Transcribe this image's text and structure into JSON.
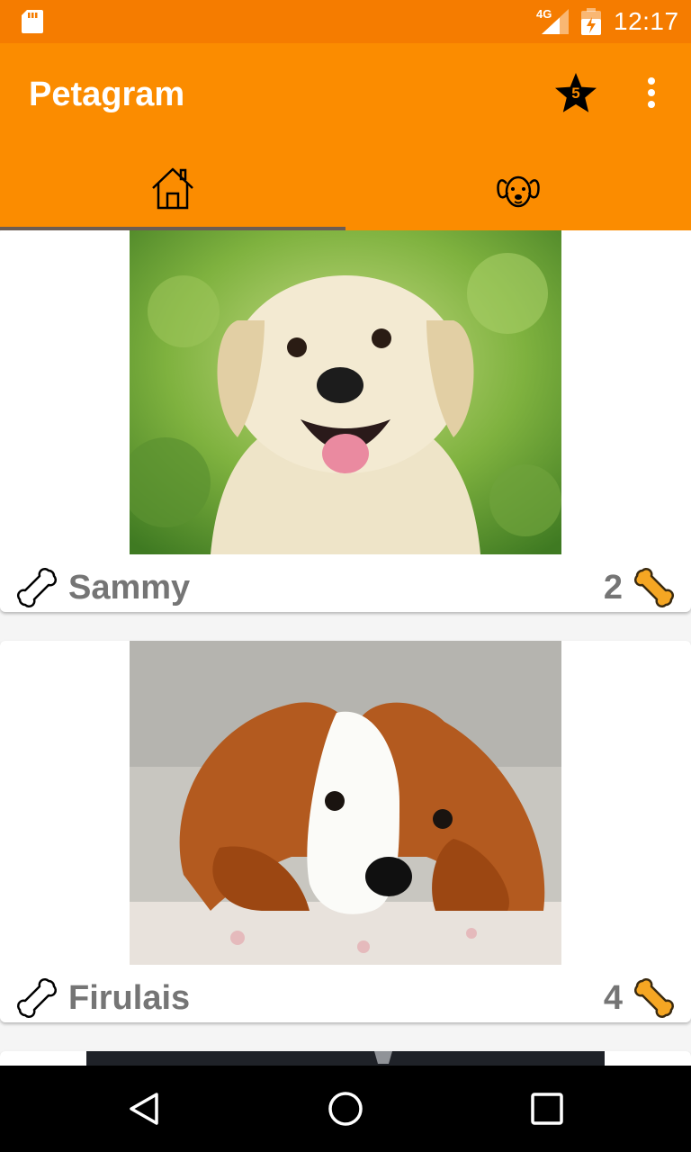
{
  "status_bar": {
    "network": "4G",
    "time": "12:17",
    "icons": [
      "sd-card-icon",
      "signal-icon",
      "battery-icon"
    ]
  },
  "app_bar": {
    "title": "Petagram",
    "favorites_count": "5",
    "icons": [
      "star-icon",
      "overflow-menu-icon"
    ]
  },
  "tabs": [
    {
      "name": "home",
      "icon": "house-icon",
      "selected": true
    },
    {
      "name": "profile",
      "icon": "dog-face-icon",
      "selected": false
    }
  ],
  "pets": [
    {
      "name": "Sammy",
      "likes": "2",
      "photo": "puppy-labrador-photo"
    },
    {
      "name": "Firulais",
      "likes": "4",
      "photo": "puppy-spaniel-photo"
    },
    {
      "name": "",
      "likes": "",
      "photo": "dark-pet-photo"
    }
  ],
  "nav_bar": {
    "icons": [
      "back-icon",
      "home-circle-icon",
      "recents-icon"
    ]
  },
  "colors": {
    "status_bar": "#f57c00",
    "app_bar": "#fb8c00",
    "tab_indicator": "#6d5d53",
    "text_secondary": "#757575",
    "bone_fill": "#f5a623"
  }
}
